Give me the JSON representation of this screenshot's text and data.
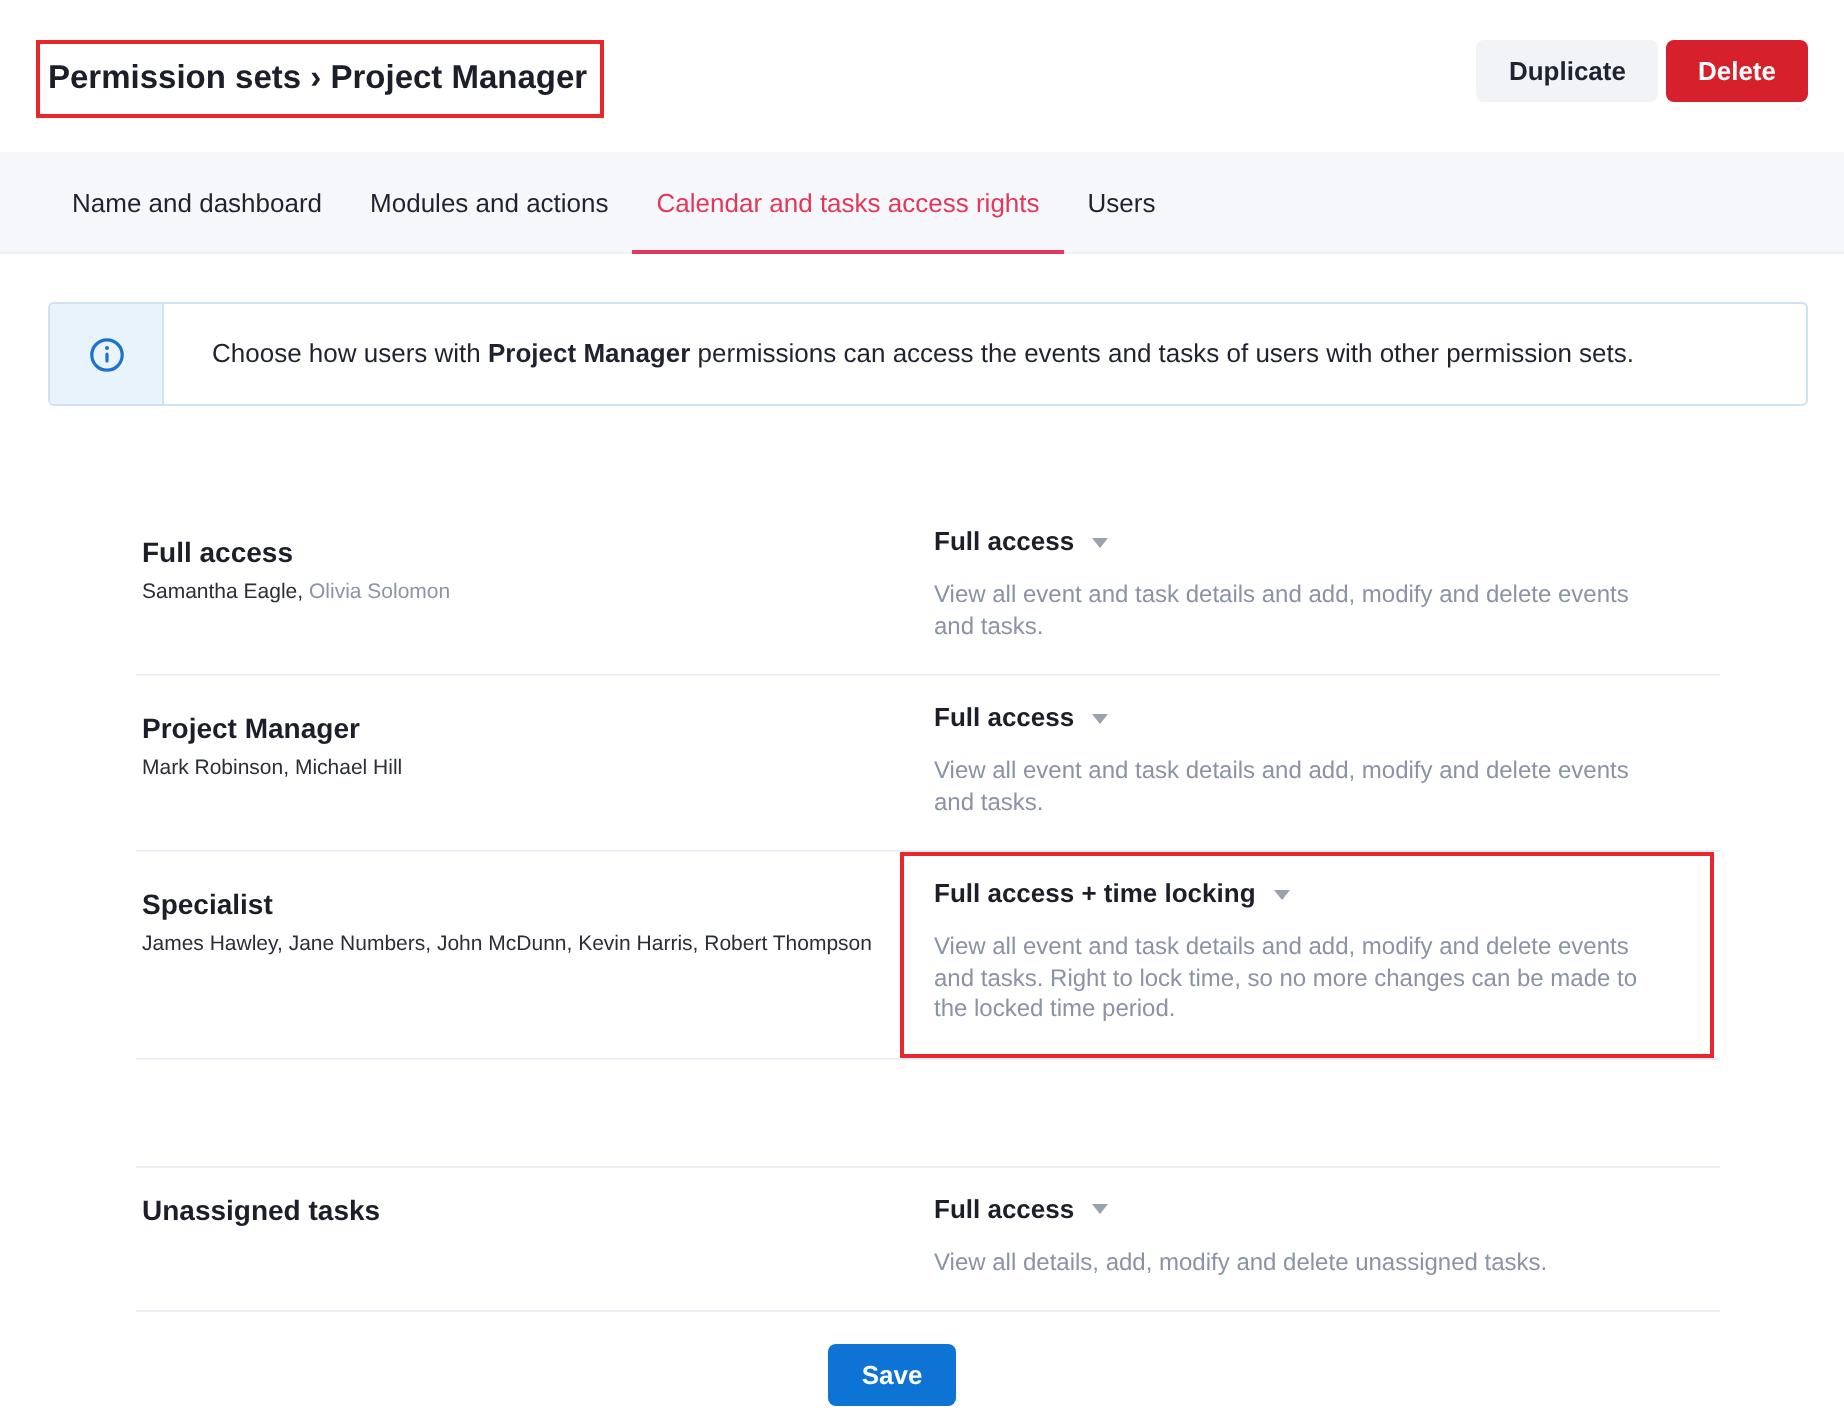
{
  "header": {
    "title": "Permission sets › Project Manager",
    "highlighted": true,
    "buttons": [
      {
        "label": "Duplicate",
        "kind": "secondary"
      },
      {
        "label": "Delete",
        "kind": "danger"
      }
    ]
  },
  "tabs": [
    {
      "label": "Name and dashboard",
      "selected": false
    },
    {
      "label": "Modules and actions",
      "selected": false
    },
    {
      "label": "Calendar and tasks access rights",
      "selected": true
    },
    {
      "label": "Users",
      "selected": false
    }
  ],
  "info_banner": {
    "text": "Choose how users with **Project Manager** permissions can access the events and tasks of users with other permission sets."
  },
  "permission_sets": [
    {
      "name": "Full access",
      "members": [
        {
          "name": "Samantha Eagle,",
          "inactive": false
        },
        {
          "name": "Olivia Solomon",
          "inactive": true
        }
      ],
      "access": {
        "label": "Full access",
        "description": "View all event and task details and add, modify and delete events and tasks.",
        "highlighted": false
      }
    },
    {
      "name": "Project Manager",
      "members": [
        {
          "name": "Mark Robinson,",
          "inactive": false
        },
        {
          "name": "Michael Hill",
          "inactive": false
        }
      ],
      "access": {
        "label": "Full access",
        "description": "View all event and task details and add, modify and delete events and tasks.",
        "highlighted": false
      }
    },
    {
      "name": "Specialist",
      "members": [
        {
          "name": "James Hawley,",
          "inactive": false
        },
        {
          "name": "Jane Numbers,",
          "inactive": false
        },
        {
          "name": "John McDunn,",
          "inactive": false
        },
        {
          "name": "Kevin Harris,",
          "inactive": false
        },
        {
          "name": "Robert Thompson",
          "inactive": false
        }
      ],
      "access": {
        "label": "Full access + time locking",
        "description": "View all event and task details and add, modify and delete events and tasks. Right to lock time, so no more changes can be made to the locked time period.",
        "highlighted": true
      }
    }
  ],
  "unassigned_tasks": {
    "name": "Unassigned tasks",
    "access": {
      "label": "Full access",
      "description": "View all details, add, modify and delete unassigned tasks.",
      "highlighted": false
    }
  },
  "save_button": {
    "label": "Save"
  }
}
